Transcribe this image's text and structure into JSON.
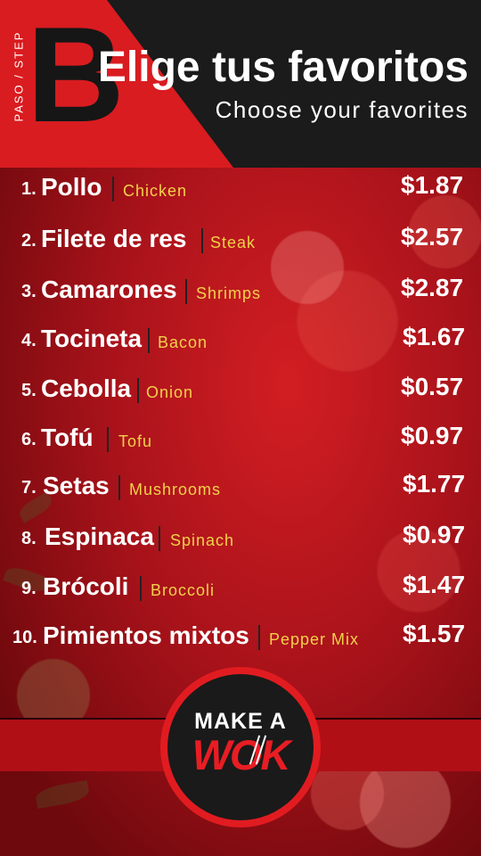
{
  "header": {
    "step_label": "PASO / STEP",
    "step_letter": "B",
    "title": "Elige tus favoritos",
    "subtitle": "Choose your favorites"
  },
  "menu": [
    {
      "num": "1.",
      "es": "Pollo",
      "en": "Chicken",
      "price": "$1.87"
    },
    {
      "num": "2.",
      "es": "Filete de res",
      "en": "Steak",
      "price": "$2.57"
    },
    {
      "num": "3.",
      "es": "Camarones",
      "en": "Shrimps",
      "price": "$2.87"
    },
    {
      "num": "4.",
      "es": "Tocineta",
      "en": "Bacon",
      "price": "$1.67"
    },
    {
      "num": "5.",
      "es": "Cebolla",
      "en": "Onion",
      "price": "$0.57"
    },
    {
      "num": "6.",
      "es": "Tofú",
      "en": "Tofu",
      "price": "$0.97"
    },
    {
      "num": "7.",
      "es": "Setas",
      "en": "Mushrooms",
      "price": "$1.77"
    },
    {
      "num": "8.",
      "es": "Espinaca",
      "en": "Spinach",
      "price": "$0.97"
    },
    {
      "num": "9.",
      "es": "Brócoli",
      "en": "Broccoli",
      "price": "$1.47"
    },
    {
      "num": "10.",
      "es": "Pimientos mixtos",
      "en": "Pepper Mix",
      "price": "$1.57"
    }
  ],
  "logo": {
    "line1": "MAKE A",
    "line2": "WOK"
  },
  "colors": {
    "accent_red": "#d91c20",
    "dark": "#1b1b1b",
    "english_text": "#f2d14a"
  }
}
